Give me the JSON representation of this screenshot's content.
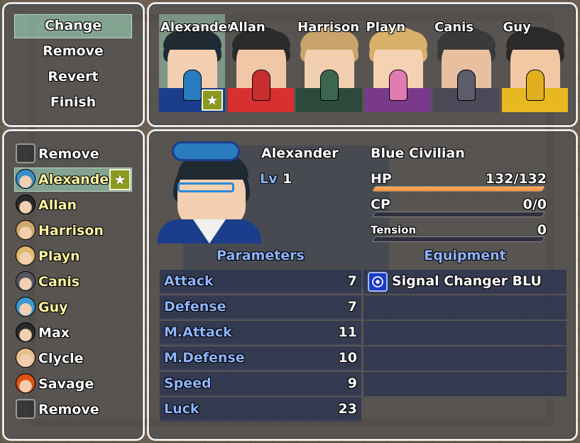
{
  "commands": [
    "Change",
    "Remove",
    "Revert",
    "Finish"
  ],
  "party": [
    {
      "name": "Alexander",
      "hair": "#1f2a33",
      "skin": "#f2cfb0",
      "collar": "#1b3d8c",
      "mini": "#2a7cc0",
      "selected": true,
      "star": true
    },
    {
      "name": "Allan",
      "hair": "#2b2b2b",
      "skin": "#f0c8a8",
      "collar": "#d83030",
      "mini": "#c83030",
      "selected": false,
      "star": false
    },
    {
      "name": "Harrison",
      "hair": "#c9a46a",
      "skin": "#f2cfae",
      "collar": "#2e4a3c",
      "mini": "#3d6650",
      "selected": false,
      "star": false
    },
    {
      "name": "Playn",
      "hair": "#d8b06a",
      "skin": "#f5d2b4",
      "collar": "#7a3a8c",
      "mini": "#e07ab0",
      "selected": false,
      "star": false
    },
    {
      "name": "Canis",
      "hair": "#3a3a3a",
      "skin": "#e8c0a0",
      "collar": "#4a4a58",
      "mini": "#5c5c6a",
      "selected": false,
      "star": false
    },
    {
      "name": "Guy",
      "hair": "#2a2a2a",
      "skin": "#f2c8a4",
      "collar": "#e8b820",
      "mini": "#e0b020",
      "selected": false,
      "star": false
    }
  ],
  "roster": [
    {
      "name": "Remove",
      "icon": "empty-slot-icon",
      "color": "",
      "style": "white"
    },
    {
      "name": "Alexander",
      "icon": "alexander-icon",
      "color": "#3a8cc8",
      "style": "yellow",
      "selected": true,
      "star": true
    },
    {
      "name": "Allan",
      "icon": "allan-icon",
      "color": "#2a2a2a",
      "style": "yellow"
    },
    {
      "name": "Harrison",
      "icon": "harrison-icon",
      "color": "#d0a870",
      "style": "yellow"
    },
    {
      "name": "Playn",
      "icon": "playn-icon",
      "color": "#e0b870",
      "style": "yellow"
    },
    {
      "name": "Canis",
      "icon": "canis-icon",
      "color": "#555560",
      "style": "yellow"
    },
    {
      "name": "Guy",
      "icon": "guy-icon",
      "color": "#3a9ad0",
      "style": "yellow"
    },
    {
      "name": "Max",
      "icon": "max-icon",
      "color": "#2a2a2a",
      "style": "white"
    },
    {
      "name": "Clycle",
      "icon": "clycle-icon",
      "color": "#e8c090",
      "style": "white"
    },
    {
      "name": "Savage",
      "icon": "savage-icon",
      "color": "#e05010",
      "style": "white"
    },
    {
      "name": "Remove",
      "icon": "empty-slot-icon",
      "color": "",
      "style": "white"
    }
  ],
  "status": {
    "name": "Alexander",
    "class": "Blue Civilian",
    "level_label": "Lv",
    "level": "1",
    "hp_label": "HP",
    "hp_value": "132/132",
    "hp_fraction": 1.0,
    "cp_label": "CP",
    "cp_value": "0/0",
    "cp_fraction": 0,
    "tension_label": "Tension",
    "tension_value": "0",
    "tension_fraction": 0
  },
  "parameters_title": "Parameters",
  "equipment_title": "Equipment",
  "parameters": [
    {
      "label": "Attack",
      "value": "7"
    },
    {
      "label": "Defense",
      "value": "7"
    },
    {
      "label": "M.Attack",
      "value": "11"
    },
    {
      "label": "M.Defense",
      "value": "10"
    },
    {
      "label": "Speed",
      "value": "9"
    },
    {
      "label": "Luck",
      "value": "23"
    }
  ],
  "equipment": [
    {
      "name": "Signal Changer BLU",
      "icon": "signal-changer-icon"
    },
    {
      "name": ""
    },
    {
      "name": ""
    },
    {
      "name": ""
    },
    {
      "name": ""
    }
  ],
  "colors": {
    "selection": "#aae6c8",
    "system_blue": "#8fb4ff",
    "hp_gauge": "#ff9a40",
    "star_badge": "#8a9a20"
  }
}
